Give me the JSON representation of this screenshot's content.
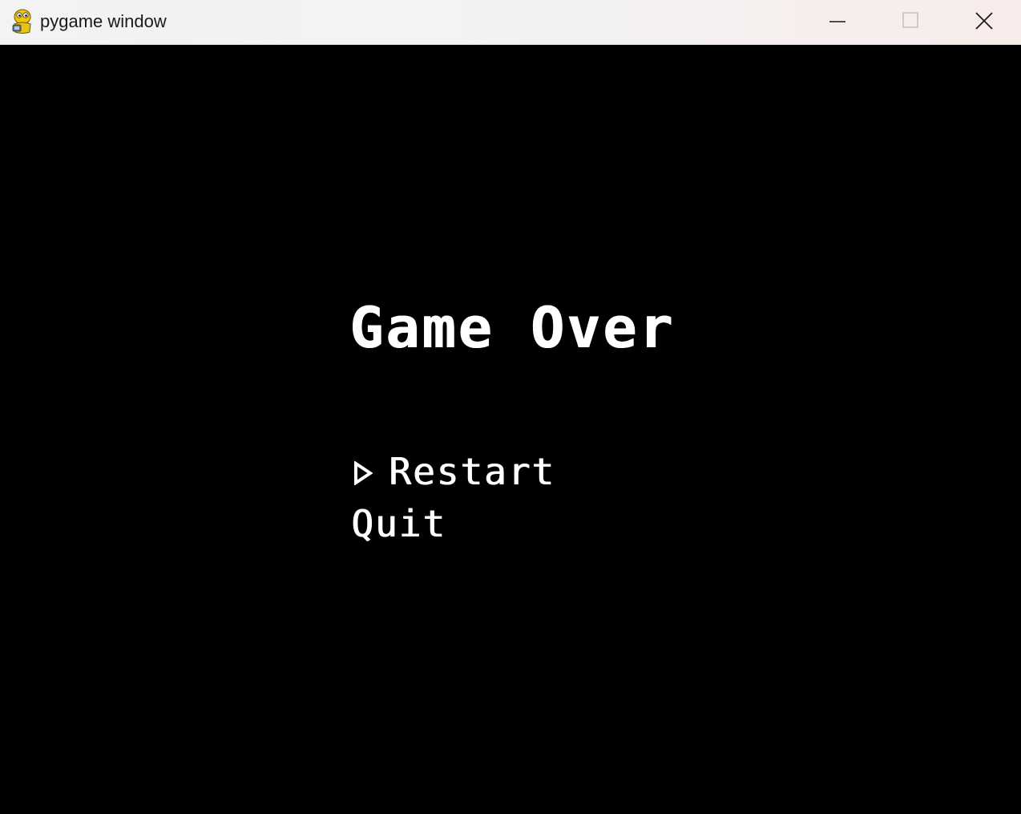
{
  "window": {
    "title": "pygame window",
    "app_icon": "pygame-snake-icon",
    "controls": {
      "minimize_icon": "minimize-icon",
      "maximize_icon": "maximize-icon",
      "close_icon": "close-icon"
    }
  },
  "game": {
    "background_color": "#000000",
    "text_color": "#ffffff",
    "title": "Game Over",
    "menu": {
      "selected_index": 0,
      "cursor_icon": "triangle-right-icon",
      "items": [
        {
          "label": "Restart"
        },
        {
          "label": "Quit"
        }
      ]
    }
  }
}
